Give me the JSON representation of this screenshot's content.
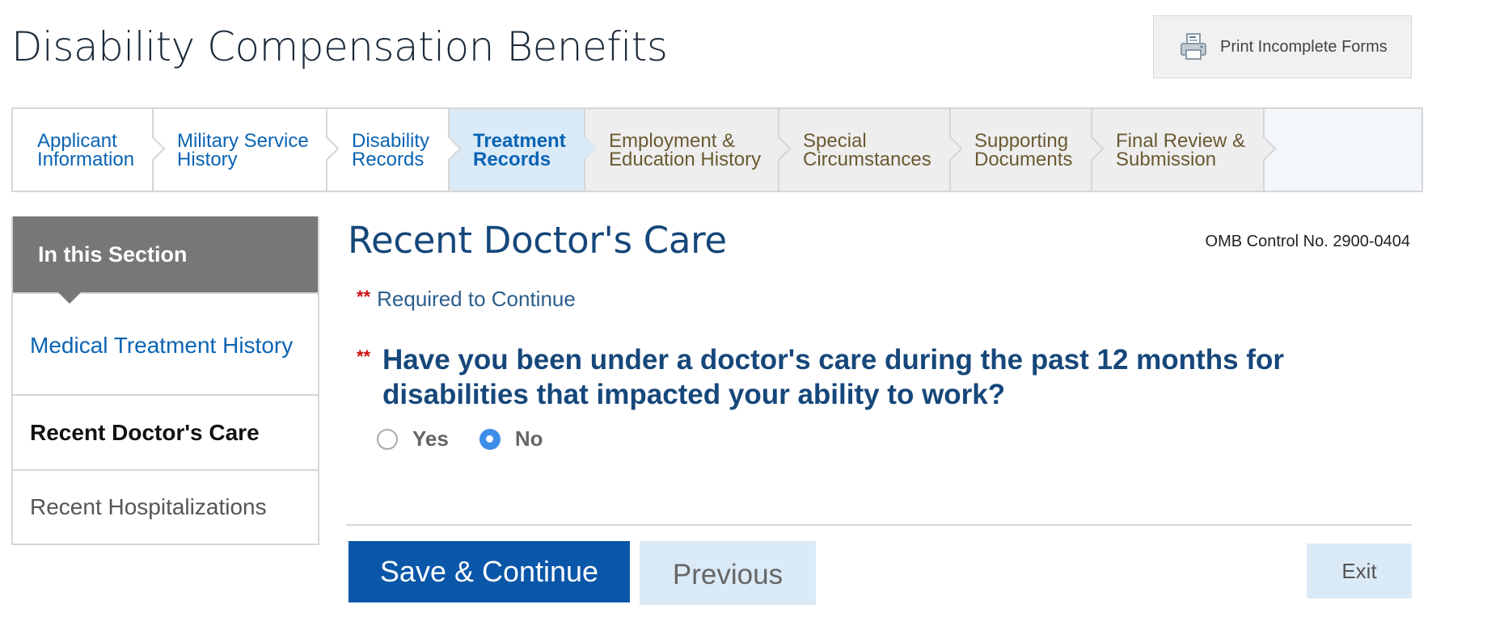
{
  "header": {
    "title": "Disability Compensation Benefits",
    "print_label": "Print Incomplete Forms"
  },
  "tabs": [
    {
      "line1": "Applicant",
      "line2": "Information",
      "state": "done"
    },
    {
      "line1": "Military Service",
      "line2": "History",
      "state": "done"
    },
    {
      "line1": "Disability",
      "line2": "Records",
      "state": "done"
    },
    {
      "line1": "Treatment",
      "line2": "Records",
      "state": "current"
    },
    {
      "line1": "Employment &",
      "line2": "Education History",
      "state": "future"
    },
    {
      "line1": "Special",
      "line2": "Circumstances",
      "state": "future"
    },
    {
      "line1": "Supporting",
      "line2": "Documents",
      "state": "future"
    },
    {
      "line1": "Final Review &",
      "line2": "Submission",
      "state": "future"
    }
  ],
  "sidebar": {
    "heading": "In this Section",
    "items": [
      {
        "label": "Medical Treatment History",
        "state": "link"
      },
      {
        "label": "Recent Doctor's Care",
        "state": "active"
      },
      {
        "label": "Recent Hospitalizations",
        "state": "inactive"
      }
    ]
  },
  "main": {
    "title": "Recent Doctor's Care",
    "omb": "OMB Control No. 2900-0404",
    "required_stars": "**",
    "required_text": "Required to Continue",
    "question": "Have you been under a doctor's care during the past 12 months for disabilities that impacted your ability to work?",
    "options": [
      {
        "label": "Yes",
        "selected": false
      },
      {
        "label": "No",
        "selected": true
      }
    ]
  },
  "footer": {
    "save_label": "Save & Continue",
    "previous_label": "Previous",
    "exit_label": "Exit"
  },
  "colors": {
    "accent": "#0a56a8",
    "link": "#0a64b4",
    "heading": "#16477a",
    "required": "#cc1111",
    "current_tab": "#dbeaf7",
    "sidebar_head": "#777777"
  },
  "icons": {
    "print": "printer-icon"
  }
}
